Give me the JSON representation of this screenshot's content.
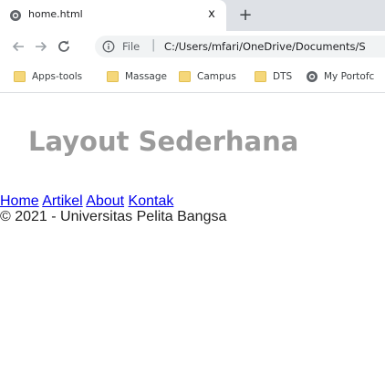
{
  "browser": {
    "tab": {
      "title": "home.html",
      "close_glyph": "x",
      "favicon_icon": "globe-icon"
    },
    "new_tab_glyph": "+",
    "nav": {
      "back_icon": "back-arrow-icon",
      "forward_icon": "forward-arrow-icon",
      "reload_icon": "reload-icon"
    },
    "address": {
      "scheme_label": "File",
      "separator": "|",
      "url": "C:/Users/mfari/OneDrive/Documents/S"
    },
    "bookmarks": [
      {
        "label": "Apps-tools",
        "icon": "folder-icon"
      },
      {
        "label": "Massage",
        "icon": "folder-icon"
      },
      {
        "label": "Campus",
        "icon": "folder-icon"
      },
      {
        "label": "DTS",
        "icon": "folder-icon"
      },
      {
        "label": "My Portofc",
        "icon": "globe-icon"
      }
    ],
    "colors": {
      "tabstrip_bg": "#dee1e6",
      "omnibox_bg": "#f1f3f4",
      "folder_fill": "#f5d77a"
    }
  },
  "page": {
    "heading": "Layout Sederhana",
    "nav_links": [
      "Home",
      "Artikel",
      "About",
      "Kontak"
    ],
    "footer": "© 2021 - Universitas Pelita Bangsa",
    "colors": {
      "heading": "#9b9b9b",
      "link": "#0000ee"
    }
  }
}
